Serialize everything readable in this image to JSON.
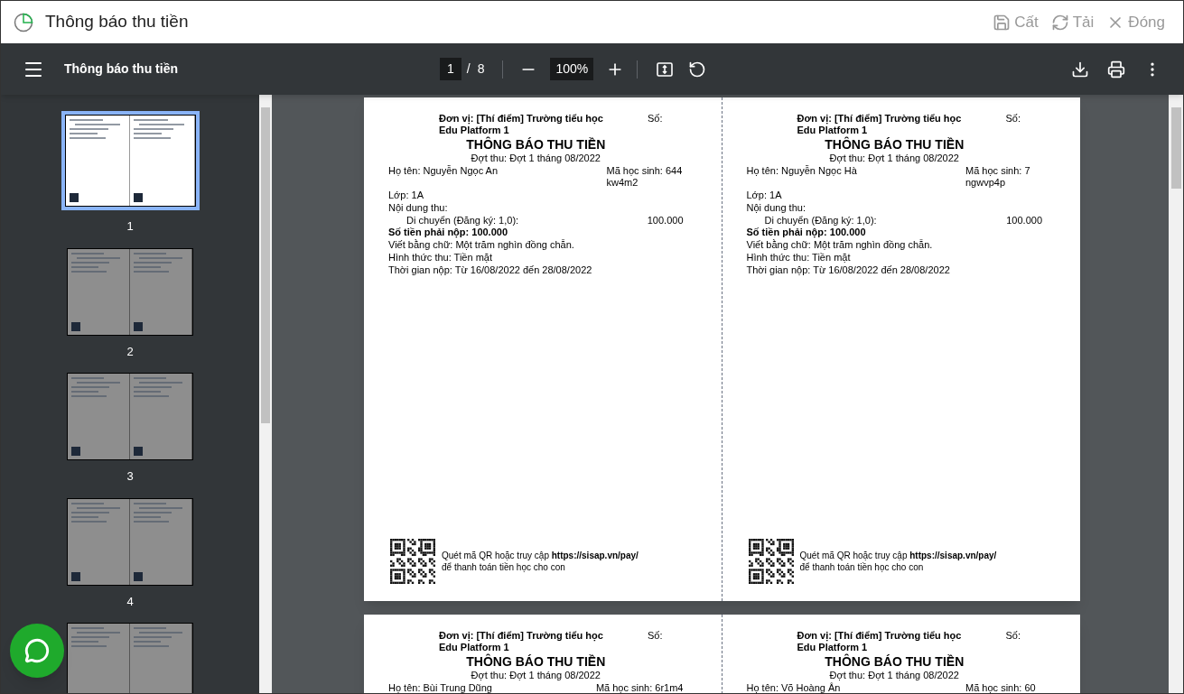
{
  "window": {
    "title": "Thông báo thu tiền",
    "actions": [
      {
        "kind": "save",
        "label": "Cất"
      },
      {
        "kind": "reload",
        "label": "Tải"
      },
      {
        "kind": "close",
        "label": "Đóng"
      }
    ]
  },
  "viewer": {
    "title": "Thông báo thu tiền",
    "page_input": "1",
    "separator": "/",
    "page_total": "8",
    "zoom": "100%"
  },
  "thumbnails": [
    {
      "label": "1",
      "selected": true
    },
    {
      "label": "2",
      "selected": false
    },
    {
      "label": "3",
      "selected": false
    },
    {
      "label": "4",
      "selected": false
    },
    {
      "selected": false
    }
  ],
  "pages": [
    {
      "notices": [
        {
          "unit_lines": [
            "Đơn vị: [Thí điểm] Trường tiểu học",
            "Edu Platform 1"
          ],
          "number_label": "Số:",
          "title": "THÔNG BÁO THU TIỀN",
          "period": "Đợt thu: Đợt 1 tháng 08/2022",
          "name": "Họ tên: Nguyễn Ngọc An",
          "student_id_lines": [
            "Mã học sinh: 644",
            "kw4m2"
          ],
          "class": "Lớp: 1A",
          "content_label": "Nội dung thu:",
          "items": [
            {
              "label": "Di chuyển (Đăng ký: 1,0):",
              "amount": "100.000"
            }
          ],
          "total": "Số tiền phải nộp: 100.000",
          "in_words": "Viết bằng chữ: Một trăm nghìn đồng chẵn.",
          "method": "Hình thức thu: Tiền mặt",
          "payment_time": "Thời gian nộp: Từ 16/08/2022 đến 28/08/2022",
          "qr_lines": [
            "Quét mã QR hoặc truy cập **https://sisap.vn/pay/**",
            "để thanh toán tiền học cho con"
          ]
        },
        {
          "unit_lines": [
            "Đơn vị: [Thí điểm] Trường tiểu học",
            "Edu Platform 1"
          ],
          "number_label": "Số:",
          "title": "THÔNG BÁO THU TIỀN",
          "period": "Đợt thu: Đợt 1 tháng 08/2022",
          "name": "Họ tên: Nguyễn Ngọc Hà",
          "student_id_lines": [
            "Mã học sinh: 7",
            "ngwvp4p"
          ],
          "class": "Lớp: 1A",
          "content_label": "Nội dung thu:",
          "items": [
            {
              "label": "Di chuyển (Đăng ký: 1,0):",
              "amount": "100.000"
            }
          ],
          "total": "Số tiền phải nộp: 100.000",
          "in_words": "Viết bằng chữ: Một trăm nghìn đồng chẵn.",
          "method": "Hình thức thu: Tiền mặt",
          "payment_time": "Thời gian nộp: Từ 16/08/2022 đến 28/08/2022",
          "qr_lines": [
            "Quét mã QR hoặc truy cập **https://sisap.vn/pay/**",
            "để thanh toán tiền học cho con"
          ]
        }
      ]
    },
    {
      "notices": [
        {
          "unit_lines": [
            "Đơn vị: [Thí điểm] Trường tiểu học",
            "Edu Platform 1"
          ],
          "number_label": "Số:",
          "title": "THÔNG BÁO THU TIỀN",
          "period": "Đợt thu: Đợt 1 tháng 08/2022",
          "name": "Họ tên: Bùi Trung Dũng",
          "student_id_lines": [
            "Mã học sinh: 6r1m4"
          ]
        },
        {
          "unit_lines": [
            "Đơn vị: [Thí điểm] Trường tiểu học",
            "Edu Platform 1"
          ],
          "number_label": "Số:",
          "title": "THÔNG BÁO THU TIỀN",
          "period": "Đợt thu: Đợt 1 tháng 08/2022",
          "name": "Họ tên: Võ Hoàng Ân",
          "student_id_lines": [
            "Mã học sinh: 60"
          ]
        }
      ]
    }
  ]
}
